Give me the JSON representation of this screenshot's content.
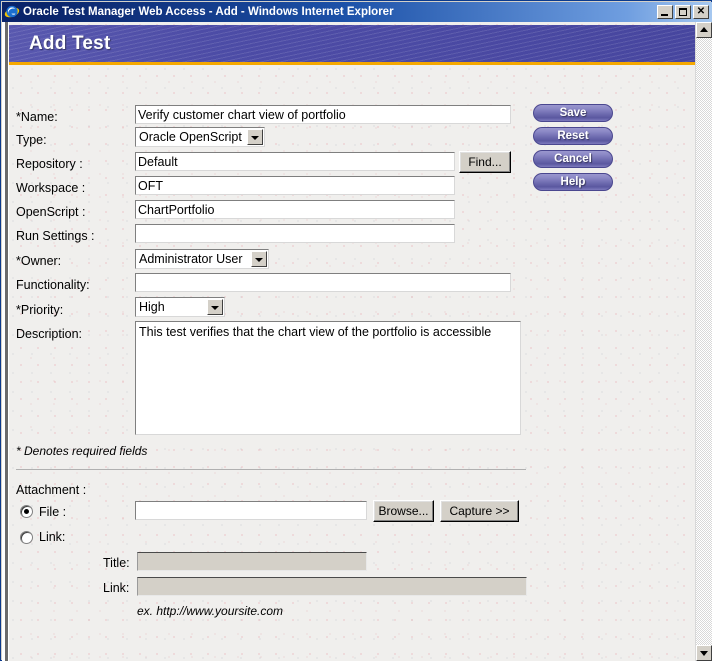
{
  "window": {
    "title": "Oracle Test Manager Web Access - Add - Windows Internet Explorer",
    "icon": "internet-explorer-icon",
    "buttons": {
      "minimize": "_",
      "maximize": "□",
      "close": "✕"
    }
  },
  "banner": {
    "title": "Add Test",
    "bg_color": "#4b4aa4",
    "underline_color": "#f5a800"
  },
  "form": {
    "fields": [
      {
        "label": "*Name:",
        "value": "Verify customer chart view of portfolio",
        "type": "text"
      },
      {
        "label": "Type:",
        "value": "Oracle OpenScript",
        "type": "select"
      },
      {
        "label": "Repository :",
        "value": "Default",
        "type": "text"
      },
      {
        "label": "Workspace :",
        "value": "OFT",
        "type": "text"
      },
      {
        "label": "OpenScript :",
        "value": "ChartPortfolio",
        "type": "text"
      },
      {
        "label": "Run Settings :",
        "value": "",
        "type": "text"
      },
      {
        "label": "*Owner:",
        "value": "Administrator User",
        "type": "select"
      },
      {
        "label": "Functionality:",
        "value": "",
        "type": "text"
      },
      {
        "label": "*Priority:",
        "value": "High",
        "type": "select"
      },
      {
        "label": "Description:",
        "value": "This test verifies that the chart view of the portfolio is accessible",
        "type": "textarea"
      }
    ],
    "find_button": "Find...",
    "required_note": "* Denotes required fields"
  },
  "actions": {
    "save": "Save",
    "reset": "Reset",
    "cancel": "Cancel",
    "help": "Help",
    "color": "#6f6cb0"
  },
  "attachment": {
    "heading": "Attachment :",
    "file_label": "File :",
    "file_value": "",
    "file_selected": true,
    "browse": "Browse...",
    "capture": "Capture >>",
    "link_label": "Link:",
    "link_selected": false,
    "title_label": "Title:",
    "title_value": "",
    "link_field_label": "Link:",
    "link_field_value": "",
    "example": "ex. http://www.yoursite.com"
  },
  "scrollbar": {
    "up_arrow": "▲",
    "down_arrow": "▼"
  }
}
